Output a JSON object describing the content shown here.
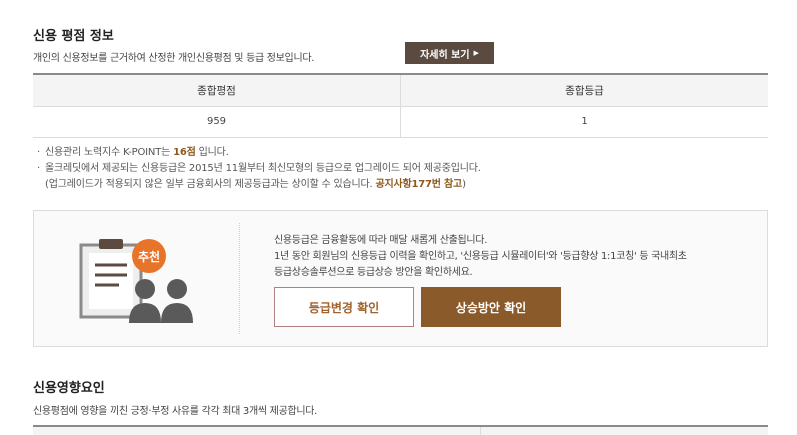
{
  "credit_info": {
    "title": "신용 평점 정보",
    "description": "개인의 신용정보를 근거하여 산정한 개인신용평점 및 등급 정보입니다.",
    "detail_button": "자세히 보기",
    "table": {
      "headers": [
        "종합평점",
        "종합등급"
      ],
      "values": [
        "959",
        "1"
      ]
    },
    "notes": {
      "line1_prefix": "신용관리 노력지수 K-POINT는 ",
      "line1_highlight": "16점",
      "line1_suffix": " 입니다.",
      "line2": "올크레딧에서 제공되는 신용등급은 2015년 11월부터 최신모형의 등급으로 업그레이드 되어 제공중입니다.",
      "line3_prefix": "(업그레이드가 적용되지 않은 일부 금융회사의 제공등급과는 상이할 수 있습니다. ",
      "line3_highlight": "공지사항177번 참고",
      "line3_suffix": ")"
    }
  },
  "promo": {
    "badge": "추천",
    "line1": "신용등급은 금융활동에 따라 매달 새롭게 산출됩니다.",
    "line2": "1년 동안 회원님의 신용등급 이력을 확인하고, '신용등급 시뮬레이터'와 '등급향상 1:1코칭' 등 국내최초",
    "line3": "등급상승솔루션으로 등급상승 방안을 확인하세요.",
    "button_grade_change": "등급변경 확인",
    "button_rise_plan": "상승방안 확인"
  },
  "factors": {
    "title": "신용영향요인",
    "description": "신용평점에 영향을 끼친 긍정·부정 사유를 각각 최대 3개씩 제공합니다."
  },
  "colors": {
    "dark_brown": "#5a4a40",
    "accent_brown": "#8b5a2b",
    "badge_orange": "#e8742a",
    "highlight": "#8a5a1e"
  }
}
